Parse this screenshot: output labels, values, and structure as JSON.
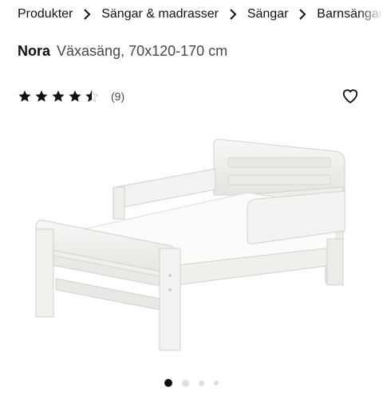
{
  "breadcrumb": {
    "items": [
      "Produkter",
      "Sängar & madrasser",
      "Sängar",
      "Barnsängar"
    ]
  },
  "product": {
    "name": "Nora",
    "description": "Växasäng, 70x120-170 cm"
  },
  "rating": {
    "value": 4.5,
    "max": 5,
    "count_label": "(9)"
  },
  "icons": {
    "separator": "chevron-right-icon",
    "wishlist": "heart-icon",
    "star": "star-icon"
  },
  "carousel": {
    "total": 4,
    "active_index": 0
  },
  "colors": {
    "text": "#111111",
    "muted": "#484848",
    "dot_active": "#111111",
    "dot_inactive": "#dfdfdf"
  }
}
